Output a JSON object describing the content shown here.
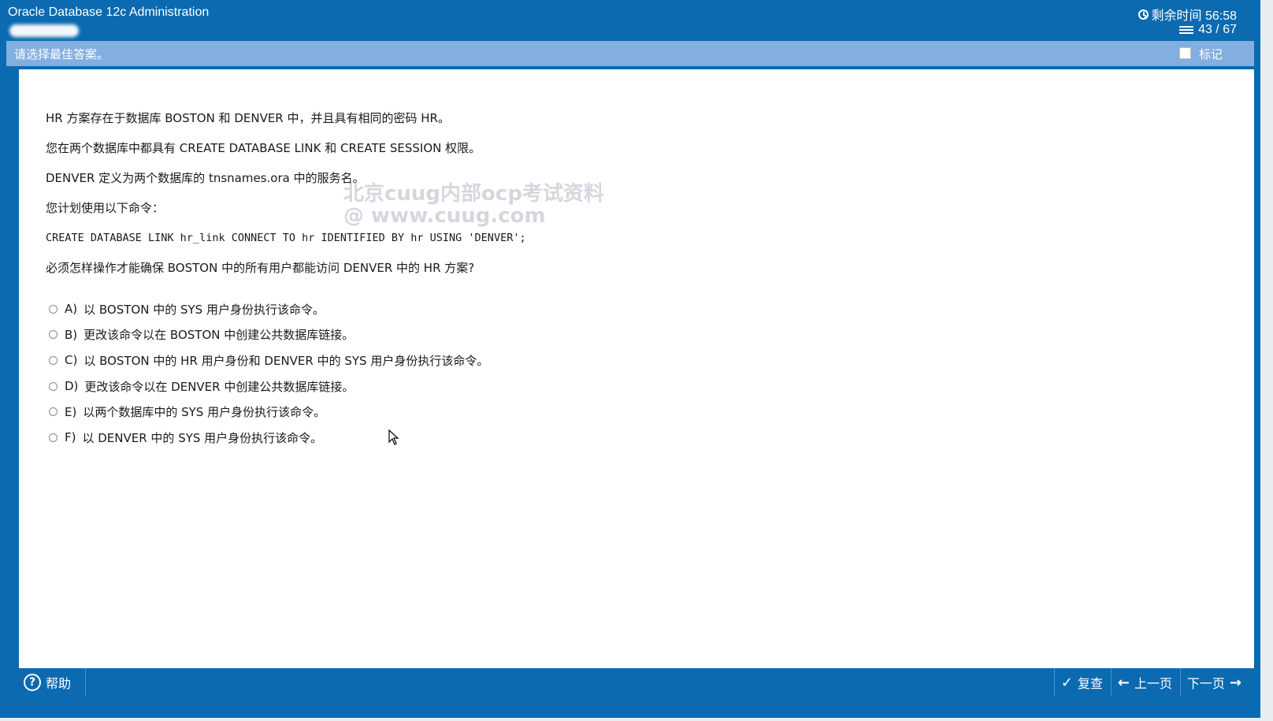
{
  "app_title": "Oracle Database 12c Administration",
  "timer": {
    "label": "剩余时间 56:58",
    "icon": "clock-icon"
  },
  "progress": {
    "label": "43 / 67",
    "icon": "list-icon"
  },
  "instruction": "请选择最佳答案。",
  "mark_label": "标记",
  "question": {
    "lines": [
      "HR 方案存在于数据库 BOSTON 和 DENVER 中，并且具有相同的密码 HR。",
      "您在两个数据库中都具有 CREATE DATABASE LINK 和 CREATE SESSION 权限。",
      "DENVER 定义为两个数据库的 tnsnames.ora 中的服务名。",
      "您计划使用以下命令：",
      "CREATE DATABASE LINK hr_link CONNECT TO hr IDENTIFIED BY hr USING 'DENVER';",
      "必须怎样操作才能确保 BOSTON 中的所有用户都能访问 DENVER 中的 HR 方案?"
    ]
  },
  "options": [
    {
      "letter": "A)",
      "text": "以 BOSTON 中的 SYS 用户身份执行该命令。"
    },
    {
      "letter": "B)",
      "text": "更改该命令以在 BOSTON 中创建公共数据库链接。"
    },
    {
      "letter": "C)",
      "text": "以 BOSTON 中的 HR 用户身份和 DENVER 中的 SYS 用户身份执行该命令。"
    },
    {
      "letter": "D)",
      "text": "更改该命令以在 DENVER 中创建公共数据库链接。"
    },
    {
      "letter": "E)",
      "text": "以两个数据库中的 SYS 用户身份执行该命令。"
    },
    {
      "letter": "F)",
      "text": "以 DENVER 中的 SYS 用户身份执行该命令。"
    }
  ],
  "watermark": {
    "line1": "北京cuug内部ocp考试资料",
    "line2": "@ www.cuug.com"
  },
  "footer": {
    "help": "帮助",
    "review": "复查",
    "prev": "上一页",
    "next": "下一页"
  },
  "colors": {
    "primary": "#0b6ab0",
    "instruction_bar": "#83aee0"
  }
}
